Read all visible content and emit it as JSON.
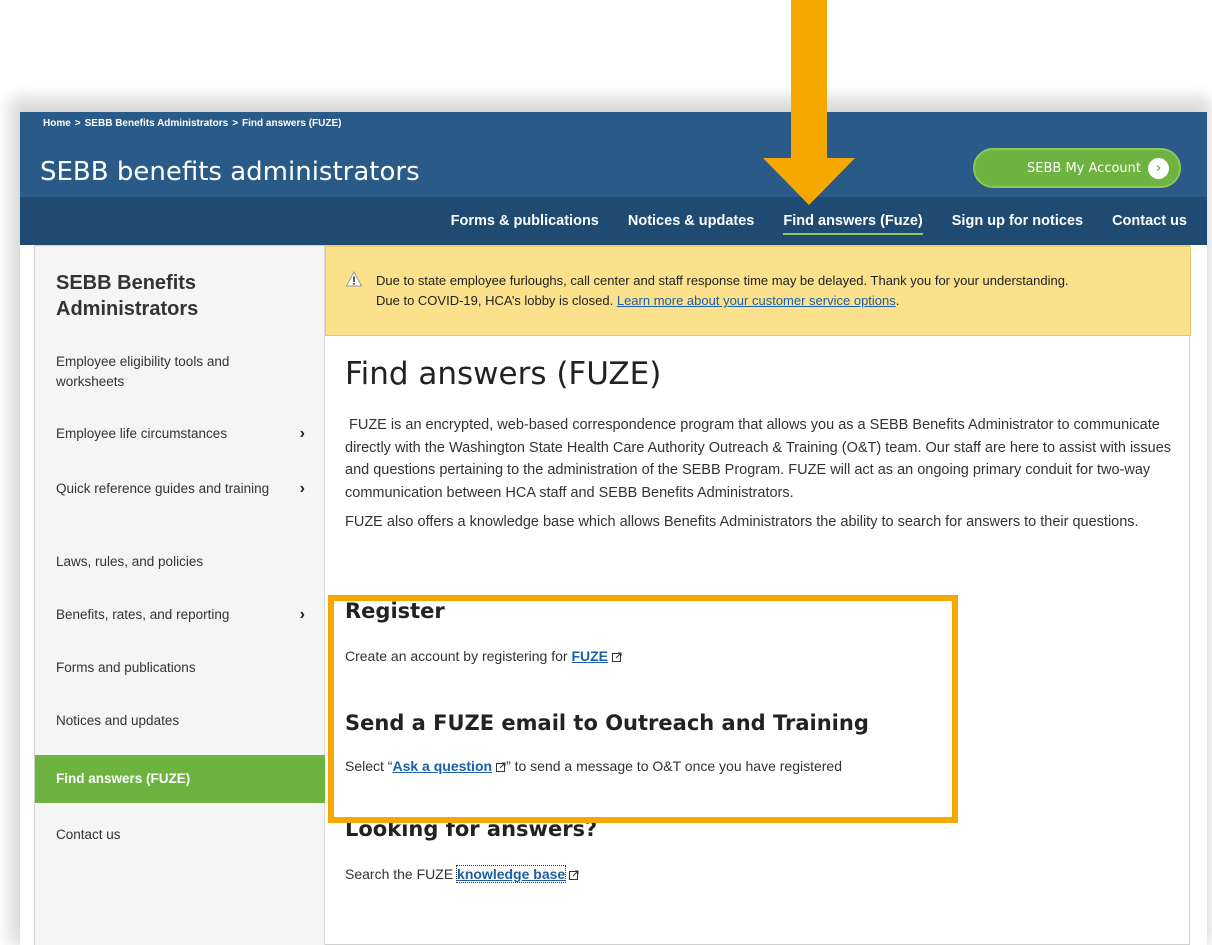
{
  "breadcrumb": [
    "Home",
    "SEBB Benefits Administrators",
    "Find answers (FUZE)"
  ],
  "breadcrumb_separator": ">",
  "site_title": "SEBB benefits administrators",
  "account_button": "SEBB My Account",
  "topnav": [
    {
      "label": "Forms & publications"
    },
    {
      "label": "Notices & updates"
    },
    {
      "label": "Find answers (Fuze)",
      "active": true
    },
    {
      "label": "Sign up for notices"
    },
    {
      "label": "Contact us"
    }
  ],
  "sidebar": {
    "heading": "SEBB Benefits Administrators",
    "items": [
      {
        "label": "Employee eligibility tools and worksheets",
        "has_submenu": false
      },
      {
        "label": "Employee life circumstances",
        "has_submenu": true
      },
      {
        "label": "Quick reference guides and training",
        "has_submenu": true
      },
      {
        "label": "Laws, rules, and policies",
        "has_submenu": false
      },
      {
        "label": "Benefits, rates, and reporting",
        "has_submenu": true
      },
      {
        "label": "Forms and publications",
        "has_submenu": false
      },
      {
        "label": "Notices and updates",
        "has_submenu": false
      },
      {
        "label": "Find answers (FUZE)",
        "has_submenu": false,
        "active": true
      },
      {
        "label": "Contact us",
        "has_submenu": false
      }
    ],
    "chevron": "›"
  },
  "alert": {
    "line1": "Due to state employee furloughs, call center and staff response time may be delayed. Thank you for your understanding.",
    "line2_prefix": "Due to COVID-19, HCA’s lobby is closed. ",
    "line2_link": "Learn more about your customer service options",
    "line2_suffix": "."
  },
  "main": {
    "title": "Find answers (FUZE)",
    "intro": "FUZE is an encrypted, web-based correspondence program that allows you as a SEBB Benefits Administrator to communicate directly with the Washington State Health Care Authority Outreach & Training (O&T) team. Our staff are here to assist with issues and questions pertaining to the administration of the SEBB Program. FUZE will act as an ongoing primary conduit for two-way communication between HCA staff and SEBB Benefits Administrators.",
    "kb_intro": "FUZE also offers a knowledge base which allows Benefits Administrators the ability to search for answers to their questions.",
    "register": {
      "heading": "Register",
      "text_prefix": "Create an account by registering for ",
      "link": "FUZE"
    },
    "send_email": {
      "heading": "Send a FUZE email to Outreach and Training",
      "text_prefix": "Select “",
      "link": "Ask a question",
      "text_suffix": "” to send a message to O&T once you have registered"
    },
    "looking": {
      "heading": "Looking for answers?",
      "text_prefix": "Search the FUZE ",
      "link": "knowledge base"
    }
  },
  "colors": {
    "header": "#2a5b88",
    "nav_band": "#1f4a72",
    "accent_green": "#6db33f",
    "alert_bg": "#fbe18b",
    "highlight": "#f5a800",
    "link": "#1a5fa8"
  }
}
